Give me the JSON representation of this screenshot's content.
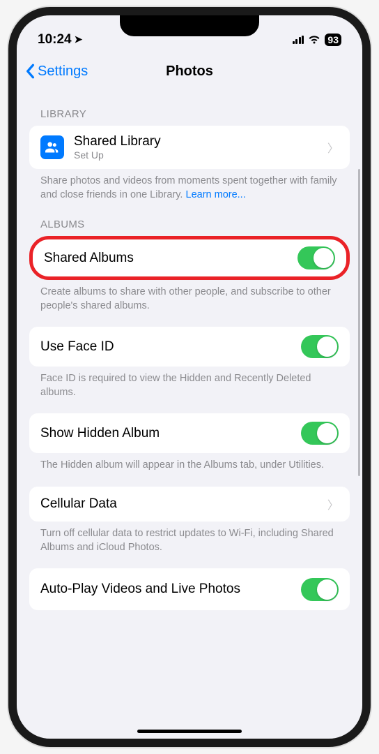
{
  "status": {
    "time": "10:24",
    "battery": "93"
  },
  "nav": {
    "back": "Settings",
    "title": "Photos"
  },
  "library": {
    "header": "LIBRARY",
    "shared_library": {
      "title": "Shared Library",
      "subtitle": "Set Up"
    },
    "footer": "Share photos and videos from moments spent together with family and close friends in one Library.",
    "learn_more": "Learn more..."
  },
  "albums": {
    "header": "ALBUMS",
    "shared_albums": {
      "title": "Shared Albums",
      "on": true
    },
    "shared_footer": "Create albums to share with other people, and subscribe to other people's shared albums.",
    "face_id": {
      "title": "Use Face ID",
      "on": true
    },
    "face_footer": "Face ID is required to view the Hidden and Recently Deleted albums.",
    "hidden": {
      "title": "Show Hidden Album",
      "on": true
    },
    "hidden_footer": "The Hidden album will appear in the Albums tab, under Utilities.",
    "cellular": {
      "title": "Cellular Data"
    },
    "cellular_footer": "Turn off cellular data to restrict updates to Wi-Fi, including Shared Albums and iCloud Photos.",
    "autoplay": {
      "title": "Auto-Play Videos and Live Photos",
      "on": true
    }
  }
}
